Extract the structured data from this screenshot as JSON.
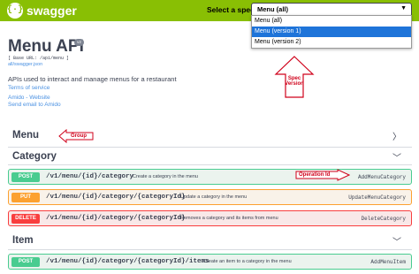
{
  "topbar": {
    "logo_glyph": "{·}",
    "brand": "swagger",
    "spec_label": "Select a spec",
    "spec_selected": "Menu (all)",
    "spec_options": [
      "Menu (all)",
      "Menu (version 1)",
      "Menu (version 2)"
    ],
    "spec_highlighted": "Menu (version 1)"
  },
  "info": {
    "title": "Menu API",
    "version_badge": "v2",
    "base_url": "[ Base URL: /api/menu ]",
    "spec_link": "all/swagger.json",
    "description": "APIs used to interact and manage menus for a restaurant",
    "terms": "Terms of service",
    "contact": "Amido - Website",
    "email": "Send email to Amido"
  },
  "annotations": {
    "spec_version": "Spec Version",
    "group": "Group",
    "operation_id": "Operation Id"
  },
  "sections": {
    "menu": "Menu",
    "category": "Category",
    "item": "Item"
  },
  "operations": [
    {
      "method": "POST",
      "path": "/v1/menu/{id}/category",
      "summary": "Create a category in the menu",
      "operation_id": "AddMenuCategory"
    },
    {
      "method": "PUT",
      "path": "/v1/menu/{id}/category/{categoryId}",
      "summary": "Update a category in the menu",
      "operation_id": "UpdateMenuCategory"
    },
    {
      "method": "DELETE",
      "path": "/v1/menu/{id}/category/{categoryId}",
      "summary": "Removes a category and its items from menu",
      "operation_id": "DeleteCategory"
    },
    {
      "method": "POST",
      "path": "/v1/menu/{id}/category/{categoryId}/items",
      "summary": "Create an item to a category in the menu",
      "operation_id": "AddMenuItem"
    }
  ],
  "colors": {
    "topbar": "#89bf04",
    "post": "#49cc90",
    "put": "#fca130",
    "delete": "#f93e3e",
    "annotation": "#d0021b",
    "link": "#4990e2"
  }
}
